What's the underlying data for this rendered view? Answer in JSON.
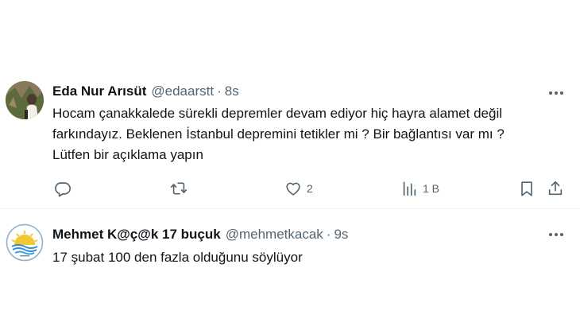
{
  "tweets": [
    {
      "author_name": "Eda Nur Arısüt",
      "handle": "@edaarstt",
      "separator": "·",
      "time": "8s",
      "text_lines": [
        "Hocam çanakkalede sürekli depremler devam ediyor hiç hayra alamet değil",
        "farkındayız. Beklenen İstanbul depremini tetikler mi ? Bir bağlantısı var mı ?",
        "Lütfen bir açıklama yapın"
      ],
      "actions": {
        "reply_icon": "reply-icon",
        "retweet_icon": "retweet-icon",
        "like_icon": "heart-icon",
        "like_count": "2",
        "views_icon": "views-chart-icon",
        "views_count": "1 B",
        "bookmark_icon": "bookmark-icon",
        "share_icon": "share-icon"
      }
    },
    {
      "author_name": "Mehmet K@ç@k 17 buçuk",
      "handle": "@mehmetkacak",
      "separator": "·",
      "time": "9s",
      "text_lines": [
        "17 şubat 100 den fazla olduğunu söylüyor"
      ]
    }
  ],
  "colors": {
    "text_primary": "#0f1419",
    "text_secondary": "#536471",
    "divider": "#eff3f4"
  }
}
